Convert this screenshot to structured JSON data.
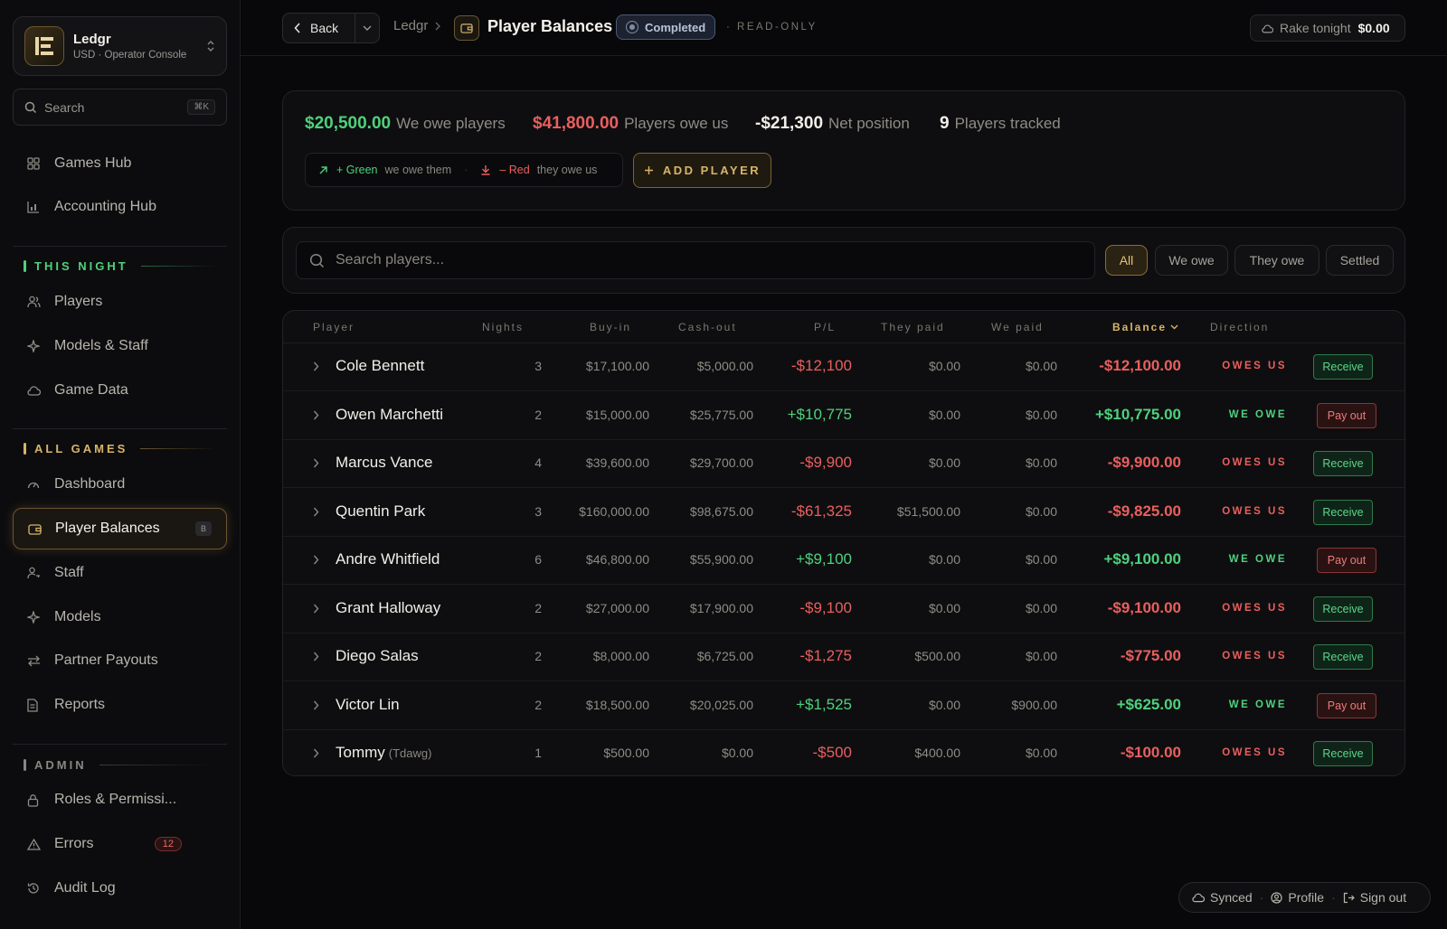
{
  "brand": {
    "name": "Ledgr",
    "subtitle": "USD · Operator Console"
  },
  "sidebar": {
    "search_label": "Search",
    "search_shortcut": "⌘K",
    "top_items": [
      {
        "label": "Games Hub",
        "icon": "grid-icon"
      },
      {
        "label": "Accounting Hub",
        "icon": "bar-chart-icon"
      }
    ],
    "sections": [
      {
        "title": "THIS NIGHT",
        "color": "#4fd17c",
        "items": [
          {
            "label": "Players",
            "icon": "users-icon"
          },
          {
            "label": "Models & Staff",
            "icon": "sparkle-icon"
          },
          {
            "label": "Game Data",
            "icon": "cloud-icon"
          }
        ]
      },
      {
        "title": "ALL GAMES",
        "color": "#d8b46a",
        "items": [
          {
            "label": "Dashboard",
            "icon": "gauge-icon"
          },
          {
            "label": "Player Balances",
            "icon": "wallet-icon",
            "active": true,
            "shortcut": "B"
          },
          {
            "label": "Staff",
            "icon": "user-key-icon"
          },
          {
            "label": "Models",
            "icon": "sparkle-icon"
          },
          {
            "label": "Partner Payouts",
            "icon": "arrows-icon"
          },
          {
            "label": "Reports",
            "icon": "document-icon"
          }
        ]
      },
      {
        "title": "ADMIN",
        "color": "#8a877f",
        "items": [
          {
            "label": "Roles & Permissi...",
            "icon": "lock-icon"
          },
          {
            "label": "Errors",
            "icon": "warning-icon",
            "count": "12"
          },
          {
            "label": "Audit Log",
            "icon": "history-icon"
          }
        ]
      }
    ]
  },
  "topbar": {
    "back_label": "Back",
    "breadcrumb_root": "Ledgr",
    "page_title": "Player Balances",
    "status": "Completed",
    "mode": "READ-ONLY",
    "rake_label": "Rake tonight",
    "rake_value": "$0.00"
  },
  "summary": {
    "we_owe_value": "$20,500.00",
    "we_owe_label": "We owe players",
    "they_owe_value": "$41,800.00",
    "they_owe_label": "Players owe us",
    "net_value": "-$21,300",
    "net_label": "Net position",
    "tracked_value": "9",
    "tracked_label": "Players tracked",
    "legend_green": "+ Green",
    "legend_green_desc": "we owe them",
    "legend_red": "– Red",
    "legend_red_desc": "they owe us",
    "add_player": "ADD PLAYER"
  },
  "filter": {
    "placeholder": "Search players...",
    "chips": [
      "All",
      "We owe",
      "They owe",
      "Settled"
    ],
    "active": "All"
  },
  "table": {
    "headers": {
      "player": "Player",
      "nights": "Nights",
      "buyin": "Buy-in",
      "cashout": "Cash-out",
      "pl": "P/L",
      "they_paid": "They paid",
      "we_paid": "We paid",
      "balance": "Balance",
      "direction": "Direction"
    },
    "rows": [
      {
        "name": "Cole Bennett",
        "nick": "",
        "nights": "3",
        "buyin": "$17,100.00",
        "cashout": "$5,000.00",
        "pl": "-$12,100",
        "they_paid": "$0.00",
        "we_paid": "$0.00",
        "balance": "-$12,100.00",
        "direction": "OWES US",
        "action": "Receive"
      },
      {
        "name": "Owen Marchetti",
        "nick": "",
        "nights": "2",
        "buyin": "$15,000.00",
        "cashout": "$25,775.00",
        "pl": "+$10,775",
        "they_paid": "$0.00",
        "we_paid": "$0.00",
        "balance": "+$10,775.00",
        "direction": "WE OWE",
        "action": "Pay out"
      },
      {
        "name": "Marcus Vance",
        "nick": "",
        "nights": "4",
        "buyin": "$39,600.00",
        "cashout": "$29,700.00",
        "pl": "-$9,900",
        "they_paid": "$0.00",
        "we_paid": "$0.00",
        "balance": "-$9,900.00",
        "direction": "OWES US",
        "action": "Receive"
      },
      {
        "name": "Quentin Park",
        "nick": "",
        "nights": "3",
        "buyin": "$160,000.00",
        "cashout": "$98,675.00",
        "pl": "-$61,325",
        "they_paid": "$51,500.00",
        "we_paid": "$0.00",
        "balance": "-$9,825.00",
        "direction": "OWES US",
        "action": "Receive"
      },
      {
        "name": "Andre Whitfield",
        "nick": "",
        "nights": "6",
        "buyin": "$46,800.00",
        "cashout": "$55,900.00",
        "pl": "+$9,100",
        "they_paid": "$0.00",
        "we_paid": "$0.00",
        "balance": "+$9,100.00",
        "direction": "WE OWE",
        "action": "Pay out"
      },
      {
        "name": "Grant Halloway",
        "nick": "",
        "nights": "2",
        "buyin": "$27,000.00",
        "cashout": "$17,900.00",
        "pl": "-$9,100",
        "they_paid": "$0.00",
        "we_paid": "$0.00",
        "balance": "-$9,100.00",
        "direction": "OWES US",
        "action": "Receive"
      },
      {
        "name": "Diego Salas",
        "nick": "",
        "nights": "2",
        "buyin": "$8,000.00",
        "cashout": "$6,725.00",
        "pl": "-$1,275",
        "they_paid": "$500.00",
        "we_paid": "$0.00",
        "balance": "-$775.00",
        "direction": "OWES US",
        "action": "Receive"
      },
      {
        "name": "Victor Lin",
        "nick": "",
        "nights": "2",
        "buyin": "$18,500.00",
        "cashout": "$20,025.00",
        "pl": "+$1,525",
        "they_paid": "$0.00",
        "we_paid": "$900.00",
        "balance": "+$625.00",
        "direction": "WE OWE",
        "action": "Pay out"
      },
      {
        "name": "Tommy",
        "nick": "(Tdawg)",
        "nights": "1",
        "buyin": "$500.00",
        "cashout": "$0.00",
        "pl": "-$500",
        "they_paid": "$400.00",
        "we_paid": "$0.00",
        "balance": "-$100.00",
        "direction": "OWES US",
        "action": "Receive"
      }
    ]
  },
  "footer": {
    "synced": "Synced",
    "profile": "Profile",
    "sign_out": "Sign out"
  },
  "colors": {
    "positive": "#4fd17c",
    "negative": "#ea5f5f",
    "accent": "#d8b46a"
  }
}
